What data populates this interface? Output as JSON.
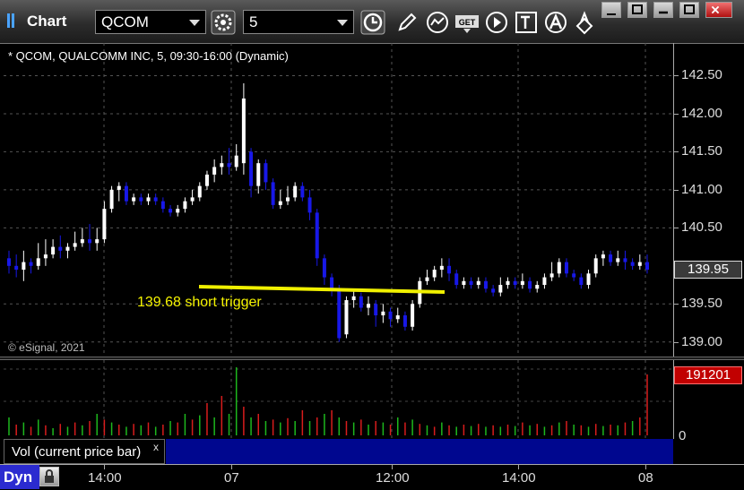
{
  "app": {
    "title": "Chart"
  },
  "toolbar": {
    "symbol": "QCOM",
    "interval": "5",
    "buttons": [
      "settings-icon",
      "clock-icon",
      "pencil-icon",
      "study-icon",
      "get-icon",
      "play-icon",
      "text-icon",
      "alert-icon",
      "link-icon"
    ]
  },
  "chart": {
    "header": "* QCOM, QUALCOMM INC, 5, 09:30-16:00 (Dynamic)",
    "copyright": "© eSignal, 2021",
    "annotation": "139.68 short trigger",
    "price_labels": [
      "142.50",
      "142.00",
      "141.50",
      "141.00",
      "140.50",
      "139.50",
      "139.00"
    ],
    "current_price": "139.95",
    "colors": {
      "up": "#ffffff",
      "down": "#1818e8",
      "line": "#f0f000",
      "vol_up": "#1db81d",
      "vol_down": "#d81c1c"
    }
  },
  "volume": {
    "legend": "Vol (current price bar)",
    "close": "x",
    "current": "191201",
    "zero": "0"
  },
  "time_axis": {
    "mode_button": "Dyn",
    "labels": [
      "14:00",
      "07",
      "12:00",
      "14:00",
      "08"
    ]
  },
  "chart_data": {
    "type": "candlestick",
    "y_range": [
      138.95,
      142.6
    ],
    "trigger_level": 139.68,
    "series": [
      {
        "o": 140.1,
        "c": 140.0,
        "h": 140.2,
        "l": 139.9
      },
      {
        "o": 140.0,
        "c": 139.95,
        "h": 140.15,
        "l": 139.85
      },
      {
        "o": 139.95,
        "c": 140.05,
        "h": 140.2,
        "l": 139.8
      },
      {
        "o": 140.05,
        "c": 140.0,
        "h": 140.1,
        "l": 139.9
      },
      {
        "o": 140.0,
        "c": 140.1,
        "h": 140.3,
        "l": 139.95
      },
      {
        "o": 140.1,
        "c": 140.15,
        "h": 140.35,
        "l": 140.0
      },
      {
        "o": 140.15,
        "c": 140.25,
        "h": 140.35,
        "l": 140.1
      },
      {
        "o": 140.25,
        "c": 140.2,
        "h": 140.4,
        "l": 140.1
      },
      {
        "o": 140.2,
        "c": 140.25,
        "h": 140.3,
        "l": 140.1
      },
      {
        "o": 140.25,
        "c": 140.3,
        "h": 140.45,
        "l": 140.2
      },
      {
        "o": 140.3,
        "c": 140.35,
        "h": 140.5,
        "l": 140.25
      },
      {
        "o": 140.35,
        "c": 140.3,
        "h": 140.55,
        "l": 140.2
      },
      {
        "o": 140.3,
        "c": 140.35,
        "h": 140.5,
        "l": 140.2
      },
      {
        "o": 140.35,
        "c": 140.75,
        "h": 140.85,
        "l": 140.3
      },
      {
        "o": 140.75,
        "c": 141.0,
        "h": 141.05,
        "l": 140.7
      },
      {
        "o": 141.0,
        "c": 141.05,
        "h": 141.1,
        "l": 140.85
      },
      {
        "o": 141.05,
        "c": 140.85,
        "h": 141.1,
        "l": 140.8
      },
      {
        "o": 140.85,
        "c": 140.9,
        "h": 140.95,
        "l": 140.8
      },
      {
        "o": 140.9,
        "c": 140.85,
        "h": 140.95,
        "l": 140.8
      },
      {
        "o": 140.85,
        "c": 140.9,
        "h": 140.95,
        "l": 140.8
      },
      {
        "o": 140.9,
        "c": 140.85,
        "h": 140.95,
        "l": 140.8
      },
      {
        "o": 140.85,
        "c": 140.75,
        "h": 140.9,
        "l": 140.7
      },
      {
        "o": 140.75,
        "c": 140.7,
        "h": 140.8,
        "l": 140.65
      },
      {
        "o": 140.7,
        "c": 140.75,
        "h": 140.8,
        "l": 140.65
      },
      {
        "o": 140.75,
        "c": 140.85,
        "h": 140.9,
        "l": 140.7
      },
      {
        "o": 140.85,
        "c": 140.9,
        "h": 141.0,
        "l": 140.8
      },
      {
        "o": 140.9,
        "c": 141.05,
        "h": 141.1,
        "l": 140.85
      },
      {
        "o": 141.05,
        "c": 141.2,
        "h": 141.25,
        "l": 141.0
      },
      {
        "o": 141.2,
        "c": 141.3,
        "h": 141.4,
        "l": 141.1
      },
      {
        "o": 141.3,
        "c": 141.35,
        "h": 141.45,
        "l": 141.2
      },
      {
        "o": 141.35,
        "c": 141.3,
        "h": 141.55,
        "l": 141.2
      },
      {
        "o": 141.3,
        "c": 141.45,
        "h": 141.6,
        "l": 141.25
      },
      {
        "o": 141.35,
        "c": 142.2,
        "h": 142.4,
        "l": 141.2
      },
      {
        "o": 141.5,
        "c": 141.05,
        "h": 141.55,
        "l": 140.9
      },
      {
        "o": 141.05,
        "c": 141.35,
        "h": 141.4,
        "l": 140.95
      },
      {
        "o": 141.35,
        "c": 141.1,
        "h": 141.4,
        "l": 141.0
      },
      {
        "o": 141.1,
        "c": 140.8,
        "h": 141.15,
        "l": 140.75
      },
      {
        "o": 140.8,
        "c": 140.85,
        "h": 141.0,
        "l": 140.75
      },
      {
        "o": 140.85,
        "c": 140.9,
        "h": 141.05,
        "l": 140.8
      },
      {
        "o": 140.9,
        "c": 141.05,
        "h": 141.1,
        "l": 140.85
      },
      {
        "o": 141.05,
        "c": 140.9,
        "h": 141.1,
        "l": 140.85
      },
      {
        "o": 140.9,
        "c": 140.7,
        "h": 141.0,
        "l": 140.6
      },
      {
        "o": 140.7,
        "c": 140.1,
        "h": 140.75,
        "l": 140.0
      },
      {
        "o": 140.1,
        "c": 139.85,
        "h": 140.15,
        "l": 139.75
      },
      {
        "o": 139.85,
        "c": 139.7,
        "h": 139.9,
        "l": 139.6
      },
      {
        "o": 139.7,
        "c": 139.05,
        "h": 139.75,
        "l": 139.0
      },
      {
        "o": 139.1,
        "c": 139.55,
        "h": 139.6,
        "l": 139.05
      },
      {
        "o": 139.55,
        "c": 139.6,
        "h": 139.7,
        "l": 139.45
      },
      {
        "o": 139.6,
        "c": 139.45,
        "h": 139.65,
        "l": 139.4
      },
      {
        "o": 139.45,
        "c": 139.5,
        "h": 139.6,
        "l": 139.35
      },
      {
        "o": 139.5,
        "c": 139.35,
        "h": 139.55,
        "l": 139.2
      },
      {
        "o": 139.35,
        "c": 139.4,
        "h": 139.5,
        "l": 139.25
      },
      {
        "o": 139.4,
        "c": 139.3,
        "h": 139.45,
        "l": 139.2
      },
      {
        "o": 139.3,
        "c": 139.35,
        "h": 139.45,
        "l": 139.25
      },
      {
        "o": 139.35,
        "c": 139.2,
        "h": 139.4,
        "l": 139.15
      },
      {
        "o": 139.2,
        "c": 139.5,
        "h": 139.55,
        "l": 139.15
      },
      {
        "o": 139.5,
        "c": 139.8,
        "h": 139.85,
        "l": 139.45
      },
      {
        "o": 139.8,
        "c": 139.85,
        "h": 139.95,
        "l": 139.75
      },
      {
        "o": 139.85,
        "c": 139.95,
        "h": 140.0,
        "l": 139.8
      },
      {
        "o": 139.95,
        "c": 140.0,
        "h": 140.1,
        "l": 139.85
      },
      {
        "o": 140.0,
        "c": 139.9,
        "h": 140.1,
        "l": 139.8
      },
      {
        "o": 139.9,
        "c": 139.75,
        "h": 139.95,
        "l": 139.7
      },
      {
        "o": 139.75,
        "c": 139.8,
        "h": 139.85,
        "l": 139.7
      },
      {
        "o": 139.8,
        "c": 139.75,
        "h": 139.85,
        "l": 139.7
      },
      {
        "o": 139.75,
        "c": 139.8,
        "h": 139.85,
        "l": 139.7
      },
      {
        "o": 139.8,
        "c": 139.7,
        "h": 139.85,
        "l": 139.65
      },
      {
        "o": 139.7,
        "c": 139.65,
        "h": 139.75,
        "l": 139.6
      },
      {
        "o": 139.65,
        "c": 139.75,
        "h": 139.85,
        "l": 139.6
      },
      {
        "o": 139.75,
        "c": 139.8,
        "h": 139.85,
        "l": 139.7
      },
      {
        "o": 139.8,
        "c": 139.75,
        "h": 139.85,
        "l": 139.7
      },
      {
        "o": 139.75,
        "c": 139.8,
        "h": 139.9,
        "l": 139.7
      },
      {
        "o": 139.8,
        "c": 139.7,
        "h": 139.85,
        "l": 139.65
      },
      {
        "o": 139.7,
        "c": 139.75,
        "h": 139.8,
        "l": 139.65
      },
      {
        "o": 139.75,
        "c": 139.85,
        "h": 139.9,
        "l": 139.7
      },
      {
        "o": 139.85,
        "c": 139.9,
        "h": 140.05,
        "l": 139.8
      },
      {
        "o": 139.9,
        "c": 140.05,
        "h": 140.1,
        "l": 139.85
      },
      {
        "o": 140.05,
        "c": 139.9,
        "h": 140.1,
        "l": 139.85
      },
      {
        "o": 139.9,
        "c": 139.85,
        "h": 139.95,
        "l": 139.8
      },
      {
        "o": 139.85,
        "c": 139.75,
        "h": 139.9,
        "l": 139.7
      },
      {
        "o": 139.75,
        "c": 139.9,
        "h": 139.95,
        "l": 139.7
      },
      {
        "o": 139.9,
        "c": 140.1,
        "h": 140.15,
        "l": 139.85
      },
      {
        "o": 140.1,
        "c": 140.15,
        "h": 140.2,
        "l": 140.0
      },
      {
        "o": 140.15,
        "c": 140.05,
        "h": 140.2,
        "l": 140.0
      },
      {
        "o": 140.05,
        "c": 140.1,
        "h": 140.2,
        "l": 140.0
      },
      {
        "o": 140.1,
        "c": 140.05,
        "h": 140.2,
        "l": 139.95
      },
      {
        "o": 140.05,
        "c": 140.0,
        "h": 140.1,
        "l": 139.95
      },
      {
        "o": 140.0,
        "c": 140.05,
        "h": 140.15,
        "l": 139.95
      },
      {
        "o": 140.05,
        "c": 139.95,
        "h": 140.15,
        "l": 139.9
      }
    ],
    "volume_bars": [
      {
        "v": 0.25,
        "up": true
      },
      {
        "v": 0.15,
        "up": false
      },
      {
        "v": 0.18,
        "up": true
      },
      {
        "v": 0.12,
        "up": false
      },
      {
        "v": 0.22,
        "up": true
      },
      {
        "v": 0.14,
        "up": false
      },
      {
        "v": 0.1,
        "up": true
      },
      {
        "v": 0.16,
        "up": false
      },
      {
        "v": 0.12,
        "up": true
      },
      {
        "v": 0.18,
        "up": false
      },
      {
        "v": 0.14,
        "up": true
      },
      {
        "v": 0.2,
        "up": false
      },
      {
        "v": 0.3,
        "up": true
      },
      {
        "v": 0.22,
        "up": false
      },
      {
        "v": 0.18,
        "up": true
      },
      {
        "v": 0.15,
        "up": false
      },
      {
        "v": 0.12,
        "up": true
      },
      {
        "v": 0.16,
        "up": false
      },
      {
        "v": 0.14,
        "up": true
      },
      {
        "v": 0.18,
        "up": false
      },
      {
        "v": 0.12,
        "up": true
      },
      {
        "v": 0.15,
        "up": false
      },
      {
        "v": 0.2,
        "up": true
      },
      {
        "v": 0.18,
        "up": false
      },
      {
        "v": 0.3,
        "up": true
      },
      {
        "v": 0.22,
        "up": false
      },
      {
        "v": 0.28,
        "up": true
      },
      {
        "v": 0.45,
        "up": false
      },
      {
        "v": 0.25,
        "up": true
      },
      {
        "v": 0.55,
        "up": false
      },
      {
        "v": 0.3,
        "up": true
      },
      {
        "v": 0.95,
        "up": true
      },
      {
        "v": 0.4,
        "up": false
      },
      {
        "v": 0.25,
        "up": true
      },
      {
        "v": 0.3,
        "up": false
      },
      {
        "v": 0.2,
        "up": true
      },
      {
        "v": 0.22,
        "up": false
      },
      {
        "v": 0.18,
        "up": true
      },
      {
        "v": 0.24,
        "up": false
      },
      {
        "v": 0.2,
        "up": true
      },
      {
        "v": 0.35,
        "up": false
      },
      {
        "v": 0.2,
        "up": true
      },
      {
        "v": 0.25,
        "up": false
      },
      {
        "v": 0.3,
        "up": true
      },
      {
        "v": 0.35,
        "up": false
      },
      {
        "v": 0.25,
        "up": true
      },
      {
        "v": 0.2,
        "up": false
      },
      {
        "v": 0.18,
        "up": true
      },
      {
        "v": 0.22,
        "up": false
      },
      {
        "v": 0.15,
        "up": true
      },
      {
        "v": 0.2,
        "up": false
      },
      {
        "v": 0.18,
        "up": true
      },
      {
        "v": 0.15,
        "up": false
      },
      {
        "v": 0.25,
        "up": true
      },
      {
        "v": 0.18,
        "up": false
      },
      {
        "v": 0.22,
        "up": true
      },
      {
        "v": 0.16,
        "up": false
      },
      {
        "v": 0.14,
        "up": true
      },
      {
        "v": 0.12,
        "up": false
      },
      {
        "v": 0.18,
        "up": true
      },
      {
        "v": 0.14,
        "up": false
      },
      {
        "v": 0.12,
        "up": true
      },
      {
        "v": 0.15,
        "up": false
      },
      {
        "v": 0.13,
        "up": true
      },
      {
        "v": 0.16,
        "up": false
      },
      {
        "v": 0.12,
        "up": true
      },
      {
        "v": 0.14,
        "up": false
      },
      {
        "v": 0.12,
        "up": true
      },
      {
        "v": 0.15,
        "up": false
      },
      {
        "v": 0.13,
        "up": true
      },
      {
        "v": 0.18,
        "up": false
      },
      {
        "v": 0.14,
        "up": true
      },
      {
        "v": 0.16,
        "up": false
      },
      {
        "v": 0.12,
        "up": true
      },
      {
        "v": 0.14,
        "up": false
      },
      {
        "v": 0.18,
        "up": true
      },
      {
        "v": 0.2,
        "up": false
      },
      {
        "v": 0.15,
        "up": true
      },
      {
        "v": 0.14,
        "up": false
      },
      {
        "v": 0.12,
        "up": true
      },
      {
        "v": 0.16,
        "up": false
      },
      {
        "v": 0.13,
        "up": true
      },
      {
        "v": 0.15,
        "up": false
      },
      {
        "v": 0.14,
        "up": true
      },
      {
        "v": 0.18,
        "up": false
      },
      {
        "v": 0.2,
        "up": true
      },
      {
        "v": 0.25,
        "up": false
      },
      {
        "v": 0.85,
        "up": false
      }
    ]
  }
}
